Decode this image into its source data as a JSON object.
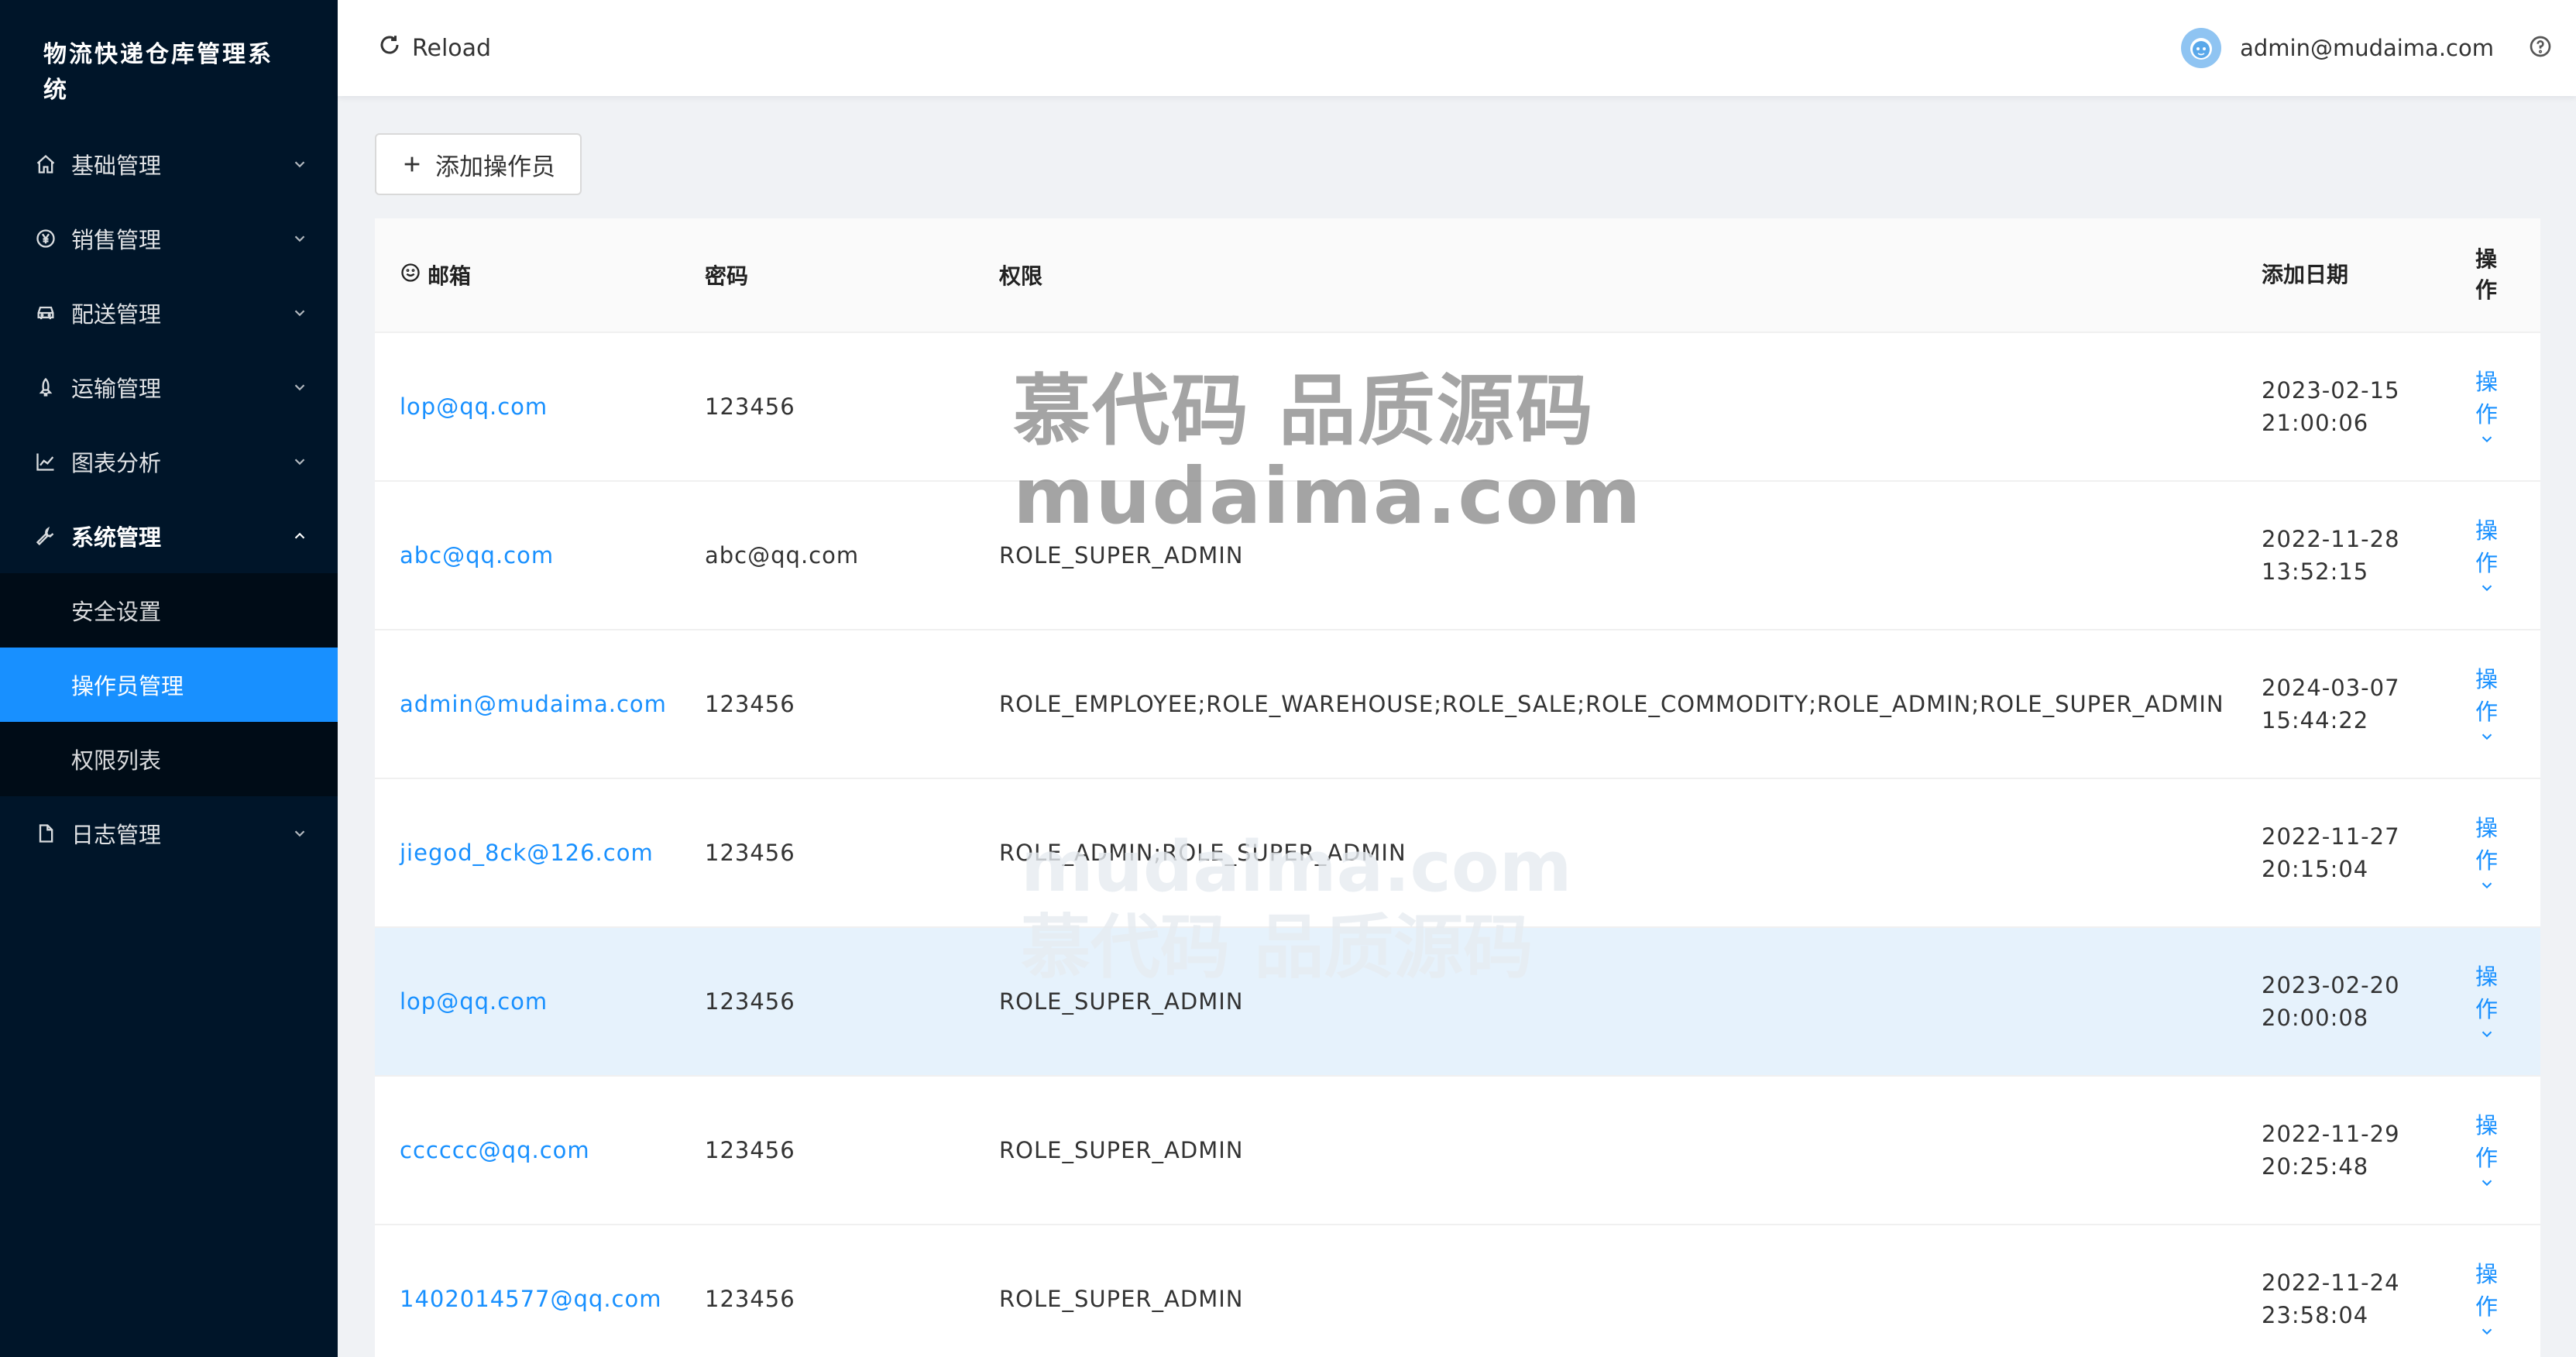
{
  "app": {
    "brand_title": "物流快递仓库管理系统"
  },
  "sidebar": {
    "items": [
      {
        "label": "基础管理",
        "icon": "home-icon"
      },
      {
        "label": "销售管理",
        "icon": "yen-icon"
      },
      {
        "label": "配送管理",
        "icon": "car-icon"
      },
      {
        "label": "运输管理",
        "icon": "rocket-icon"
      },
      {
        "label": "图表分析",
        "icon": "line-chart-icon"
      },
      {
        "label": "系统管理",
        "icon": "tool-icon"
      }
    ],
    "submenu": [
      {
        "label": "安全设置"
      },
      {
        "label": "操作员管理"
      },
      {
        "label": "权限列表"
      }
    ],
    "after_items": [
      {
        "label": "日志管理",
        "icon": "file-icon"
      }
    ]
  },
  "header": {
    "reload_label": "Reload",
    "user_email": "admin@mudaima.com"
  },
  "toolbar": {
    "add_label": "添加操作员"
  },
  "table": {
    "columns": {
      "email": "邮箱",
      "password": "密码",
      "role": "权限",
      "date": "添加日期",
      "op_line1": "操",
      "op_line2": "作"
    },
    "op_label_line1": "操",
    "op_label_line2": "作",
    "rows": [
      {
        "email": "lop@qq.com",
        "password": "123456",
        "role": "",
        "date_line1": "2023-02-15",
        "date_line2": "21:00:06"
      },
      {
        "email": "abc@qq.com",
        "password": "abc@qq.com",
        "role": "ROLE_SUPER_ADMIN",
        "date_line1": "2022-11-28",
        "date_line2": "13:52:15"
      },
      {
        "email": "admin@mudaima.com",
        "password": "123456",
        "role": "ROLE_EMPLOYEE;ROLE_WAREHOUSE;ROLE_SALE;ROLE_COMMODITY;ROLE_ADMIN;ROLE_SUPER_ADMIN",
        "date_line1": "2024-03-07",
        "date_line2": "15:44:22"
      },
      {
        "email": "jiegod_8ck@126.com",
        "password": "123456",
        "role": "ROLE_ADMIN;ROLE_SUPER_ADMIN",
        "date_line1": "2022-11-27",
        "date_line2": "20:15:04"
      },
      {
        "email": "lop@qq.com",
        "password": "123456",
        "role": "ROLE_SUPER_ADMIN",
        "date_line1": "2023-02-20",
        "date_line2": "20:00:08"
      },
      {
        "email": "cccccc@qq.com",
        "password": "123456",
        "role": "ROLE_SUPER_ADMIN",
        "date_line1": "2022-11-29",
        "date_line2": "20:25:48"
      },
      {
        "email": "1402014577@qq.com",
        "password": "123456",
        "role": "ROLE_SUPER_ADMIN",
        "date_line1": "2022-11-24",
        "date_line2": "23:58:04"
      }
    ]
  },
  "watermark": {
    "line1": "慕代码 品质源码",
    "line2": "mudaima.com"
  },
  "colors": {
    "sidebar_bg": "#001529",
    "submenu_bg": "#000c17",
    "primary": "#1890ff"
  }
}
